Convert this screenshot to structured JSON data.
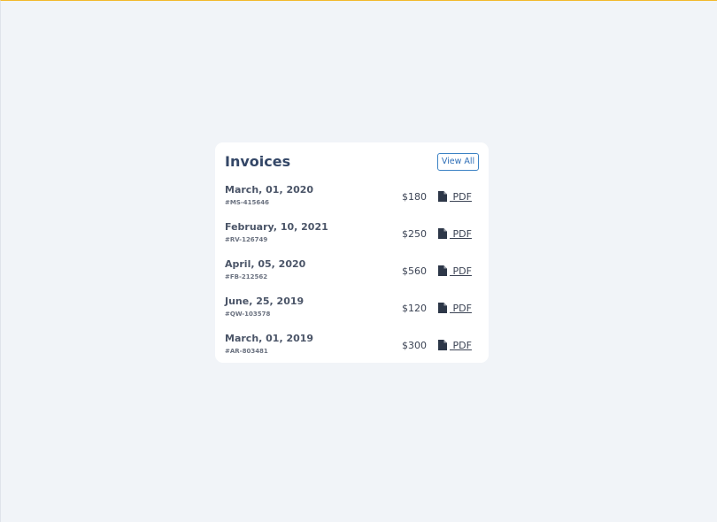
{
  "card": {
    "title": "Invoices",
    "view_all_label": "View All"
  },
  "invoices": [
    {
      "date": "March, 01, 2020",
      "code": "#MS-415646",
      "amount": "$180",
      "pdf_label": " PDF"
    },
    {
      "date": "February, 10, 2021",
      "code": "#RV-126749",
      "amount": "$250",
      "pdf_label": " PDF"
    },
    {
      "date": "April, 05, 2020",
      "code": "#FB-212562",
      "amount": "$560",
      "pdf_label": " PDF"
    },
    {
      "date": "June, 25, 2019",
      "code": "#QW-103578",
      "amount": "$120",
      "pdf_label": " PDF"
    },
    {
      "date": "March, 01, 2019",
      "code": "#AR-803481",
      "amount": "$300",
      "pdf_label": " PDF"
    }
  ],
  "icons": {
    "pdf": "file-icon"
  },
  "colors": {
    "background": "#f1f4f8",
    "card": "#ffffff",
    "accent": "#2f6fb7",
    "title": "#344767"
  }
}
